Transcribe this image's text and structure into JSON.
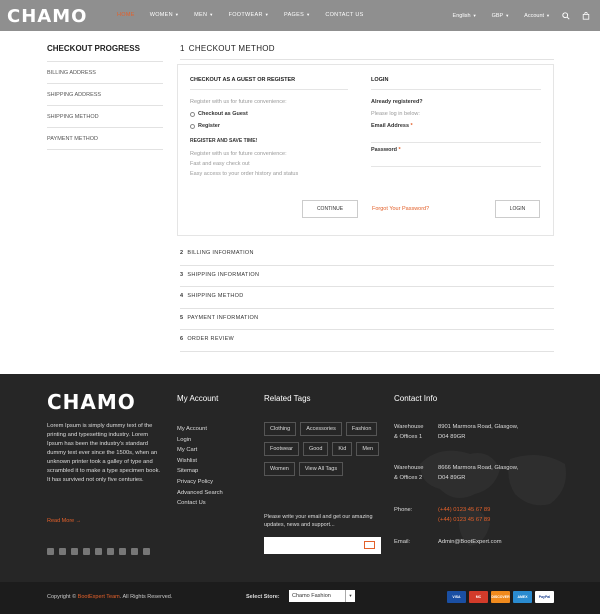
{
  "header": {
    "logo": "CHAMO",
    "nav": [
      {
        "label": "HOME",
        "active": true,
        "caret": false
      },
      {
        "label": "WOMEN",
        "active": false,
        "caret": true
      },
      {
        "label": "MEN",
        "active": false,
        "caret": true
      },
      {
        "label": "FOOTWEAR",
        "active": false,
        "caret": true
      },
      {
        "label": "PAGES",
        "active": false,
        "caret": true
      },
      {
        "label": "CONTACT US",
        "active": false,
        "caret": false
      }
    ],
    "language": "English",
    "currency": "GBP",
    "account": "Account",
    "icons": [
      "search-icon",
      "cart-icon"
    ]
  },
  "sidebar": {
    "title": "CHECKOUT PROGRESS",
    "items": [
      "BILLING ADDRESS",
      "SHIPPING ADDRESS",
      "SHIPPING METHOD",
      "PAYMENT METHOD"
    ]
  },
  "main": {
    "step_num": "1",
    "step_title": "CHECKOUT METHOD",
    "guest": {
      "heading": "CHECKOUT AS A GUEST OR REGISTER",
      "intro": "Register with us for future convenience:",
      "option_guest": "Checkout as Guest",
      "option_register": "Register",
      "save_heading": "REGISTER AND SAVE TIME!",
      "save_lines": [
        "Register with us for future convenience:",
        "Fast and easy check out",
        "Easy access to your order history and status"
      ],
      "continue_label": "CONTINUE"
    },
    "login": {
      "heading": "LOGIN",
      "already": "Already registered?",
      "please": "Please log in below:",
      "email_label": "Email Address",
      "password_label": "Password",
      "required_mark": "*",
      "forgot": "Forgot Your Password?",
      "login_label": "LOGIN"
    },
    "steps": [
      {
        "num": "2",
        "label": "BILLING INFORMATION"
      },
      {
        "num": "3",
        "label": "SHIPPING INFORMATION"
      },
      {
        "num": "4",
        "label": "SHIPPING METHOD"
      },
      {
        "num": "5",
        "label": "PAYMENT INFORMATION"
      },
      {
        "num": "6",
        "label": "ORDER REVIEW"
      }
    ]
  },
  "footer": {
    "logo": "CHAMO",
    "about": "Lorem Ipsum is simply dummy text of the printing and typesetting industry. Lorem Ipsum has been the industry's standard dummy text ever since the 1500s, when an unknown printer took a galley of type and scrambled it to make a type specimen book. It has survived not only five centuries.",
    "read_more": "Read More",
    "account_title": "My Account",
    "account_links": [
      "My Account",
      "Login",
      "My Cart",
      "Wishlist",
      "Sitemap",
      "Privacy Policy",
      "Advanced Search",
      "Contact Us"
    ],
    "tags_title": "Related Tags",
    "tags": [
      "Clothing",
      "Accessories",
      "Fashion",
      "Footwear",
      "Good",
      "Kid",
      "Men",
      "Women",
      "View All Tags"
    ],
    "newsletter_text": "Please write your email and get our amazing updates, news and support...",
    "contact_title": "Contact Info",
    "contact": {
      "warehouse1_label_1": "Warehouse",
      "warehouse1_label_2": "& Offices 1",
      "warehouse1_addr_1": "8901 Marmora Road, Glasgow,",
      "warehouse1_addr_2": "D04 89GR",
      "warehouse2_label_1": "Warehouse",
      "warehouse2_label_2": "& Offices 2",
      "warehouse2_addr_1": "8666 Marmora Road, Glasgow,",
      "warehouse2_addr_2": "D04 89GR",
      "phone_label": "Phone:",
      "phone_1": "(+44) 0123 45 67 89",
      "phone_2": "(+44) 0123 45 67 89",
      "email_label": "Email:",
      "email": "Admin@BootExpert.com"
    }
  },
  "bottom": {
    "copyright_prefix": "Copyright ©",
    "brand": "BootExpert Team",
    "copyright_suffix": "All Rights Reserved.",
    "store_label": "Select Store:",
    "store_value": "Chamo Fashion",
    "payments": [
      {
        "name": "VISA",
        "color": "#1a4fa3"
      },
      {
        "name": "MC",
        "color": "#d23b2a"
      },
      {
        "name": "DISCOVER",
        "color": "#f08a1d"
      },
      {
        "name": "AMEX",
        "color": "#2a8bd0"
      },
      {
        "name": "PayPal",
        "color": "#ffffff"
      }
    ]
  }
}
